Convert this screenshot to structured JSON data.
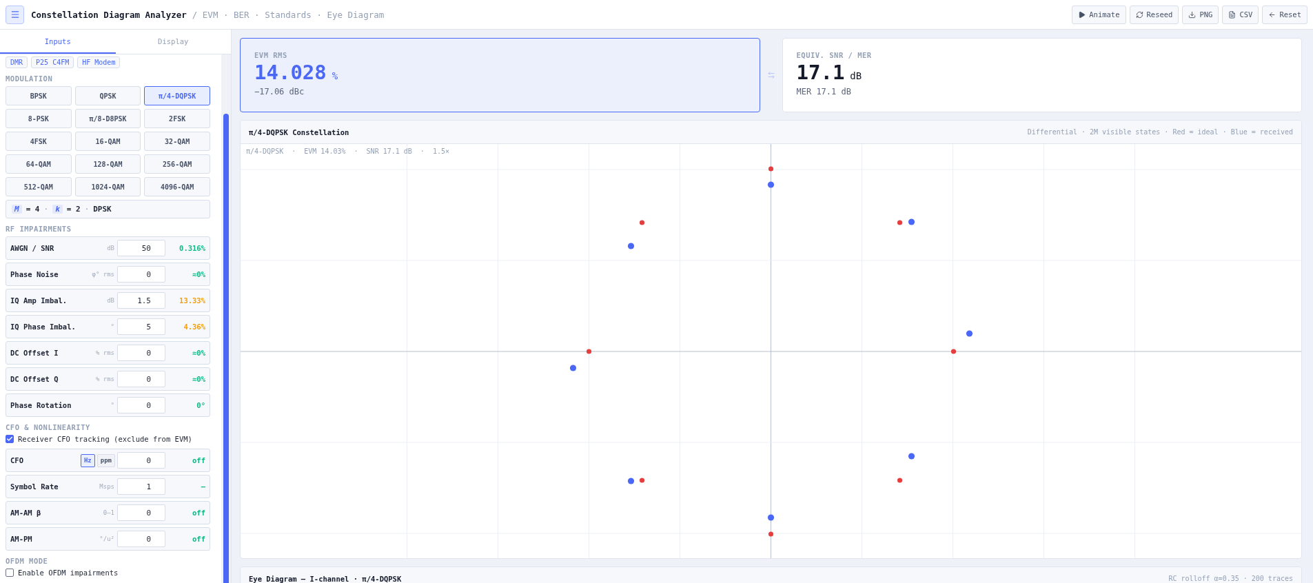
{
  "app": {
    "title": "Constellation Diagram Analyzer",
    "breadcrumb": "/ EVM · BER · Standards · Eye Diagram"
  },
  "toolbar": [
    {
      "label": "Animate"
    },
    {
      "label": "Reseed"
    },
    {
      "label": "PNG"
    },
    {
      "label": "CSV"
    },
    {
      "label": "Reset"
    }
  ],
  "sidebar": {
    "tabs": [
      {
        "label": "Inputs",
        "selected": true
      },
      {
        "label": "Display",
        "selected": false
      }
    ],
    "presets": [
      "DMR",
      "P25 C4FM",
      "HF Modem"
    ],
    "modulation": {
      "heading": "MODULATION",
      "options": [
        {
          "label": "BPSK",
          "selected": false
        },
        {
          "label": "QPSK",
          "selected": false
        },
        {
          "label": "π/4-DQPSK",
          "selected": true
        },
        {
          "label": "8-PSK",
          "selected": false
        },
        {
          "label": "π/8-D8PSK",
          "selected": false
        },
        {
          "label": "2FSK",
          "selected": false
        },
        {
          "label": "4FSK",
          "selected": false
        },
        {
          "label": "16-QAM",
          "selected": false
        },
        {
          "label": "32-QAM",
          "selected": false
        },
        {
          "label": "64-QAM",
          "selected": false
        },
        {
          "label": "128-QAM",
          "selected": false
        },
        {
          "label": "256-QAM",
          "selected": false
        },
        {
          "label": "512-QAM",
          "selected": false
        },
        {
          "label": "1024-QAM",
          "selected": false
        },
        {
          "label": "4096-QAM",
          "selected": false
        }
      ],
      "summary": {
        "m_symbol": "M",
        "m_value": "= 4",
        "k_symbol": "k",
        "k_value": "= 2",
        "family": "DPSK",
        "separator": "·"
      }
    },
    "rf": {
      "heading": "RF IMPAIRMENTS",
      "params": [
        {
          "label": "AWGN / SNR",
          "unit": "dB",
          "value": "50",
          "result": "0.316%",
          "color": "#10b981"
        },
        {
          "label": "Phase Noise",
          "unit": "φ° rms",
          "value": "0",
          "result": "≈0%",
          "color": "#10b981"
        },
        {
          "label": "IQ Amp Imbal.",
          "unit": "dB",
          "value": "1.5",
          "result": "13.33%",
          "color": "#f59e0b"
        },
        {
          "label": "IQ Phase Imbal.",
          "unit": "°",
          "value": "5",
          "result": "4.36%",
          "color": "#f59e0b"
        },
        {
          "label": "DC Offset I",
          "unit": "% rms",
          "value": "0",
          "result": "≈0%",
          "color": "#10b981"
        },
        {
          "label": "DC Offset Q",
          "unit": "% rms",
          "value": "0",
          "result": "≈0%",
          "color": "#10b981"
        },
        {
          "label": "Phase Rotation",
          "unit": "°",
          "value": "0",
          "result": "0°",
          "color": "#10b981"
        }
      ]
    },
    "cfo": {
      "heading": "CFO & NONLINEARITY",
      "tracking": {
        "label": "Receiver CFO tracking (exclude from EVM)",
        "checked": true
      },
      "params": [
        {
          "label": "CFO",
          "units": [
            {
              "label": "Hz",
              "selected": true
            },
            {
              "label": "ppm",
              "selected": false
            }
          ],
          "value": "0",
          "result": "off",
          "color": "#10b981"
        },
        {
          "label": "Symbol Rate",
          "unit": "Msps",
          "value": "1",
          "result": "—",
          "color": "#10b981"
        },
        {
          "label": "AM-AM β",
          "unit": "0–1",
          "value": "0",
          "result": "off",
          "color": "#10b981"
        },
        {
          "label": "AM-PM",
          "unit": "°/u²",
          "value": "0",
          "result": "off",
          "color": "#10b981"
        }
      ]
    },
    "ofdm": {
      "heading": "OFDM MODE",
      "enable": {
        "label": "Enable OFDM impairments",
        "checked": false
      }
    }
  },
  "metrics": [
    {
      "label": "EVM RMS",
      "value": "14.028",
      "unit": "%",
      "sub": "−17.06 dBc",
      "selected": true
    },
    {
      "label": "EQUIV. SNR / MER",
      "value": "17.1",
      "unit": "dB",
      "sub": "MER 17.1 dB",
      "selected": false
    }
  ],
  "constellation": {
    "title": "π/4-DQPSK Constellation",
    "note": "Differential · 2M visible states · Red = ideal · Blue = received",
    "overlay": "π/4-DQPSK  ·  EVM 14.03%  ·  SNR 17.1 dB  ·  1.5×"
  },
  "eye": {
    "title": "Eye Diagram — I-channel · π/4-DQPSK",
    "note": "RC rolloff α=0.35 · 200 traces"
  }
}
